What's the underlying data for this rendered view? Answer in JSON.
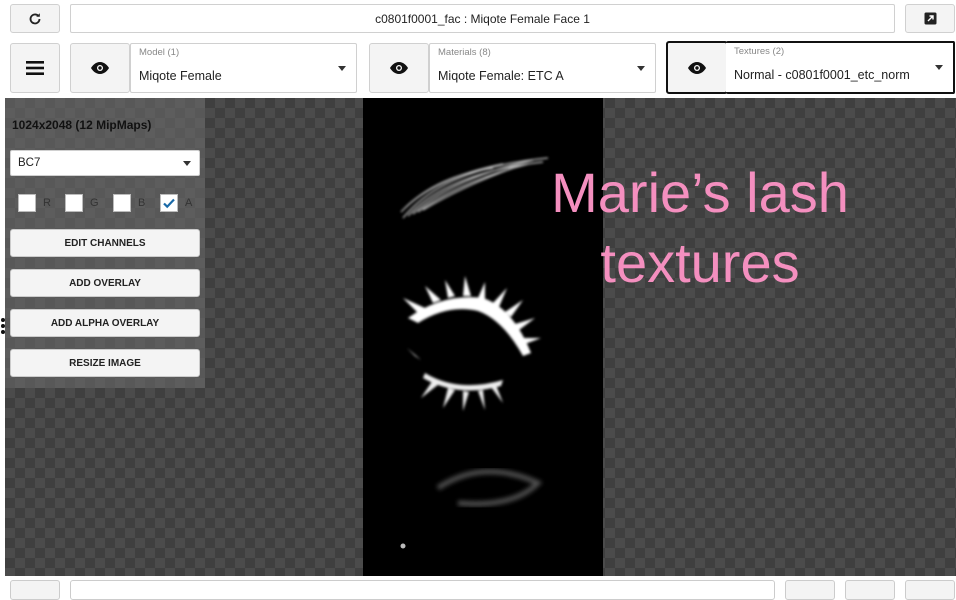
{
  "header": {
    "title": "c0801f0001_fac : Miqote Female Face 1",
    "refresh_icon": "refresh-icon",
    "popout_icon": "popout-icon"
  },
  "toolbar": {
    "menu_icon": "hamburger-icon",
    "model": {
      "label": "Model (1)",
      "value": "Miqote Female"
    },
    "materials": {
      "label": "Materials (8)",
      "value": "Miqote Female: ETC A"
    },
    "textures": {
      "label": "Textures (2)",
      "value": "Normal - c0801f0001_etc_norm"
    }
  },
  "panel": {
    "dimensions": "1024x2048 (12 MipMaps)",
    "format": "BC7",
    "channels": [
      {
        "label": "R",
        "checked": false
      },
      {
        "label": "G",
        "checked": false
      },
      {
        "label": "B",
        "checked": false
      },
      {
        "label": "A",
        "checked": true
      }
    ],
    "buttons": {
      "edit_channels": "EDIT CHANNELS",
      "add_overlay": "ADD OVERLAY",
      "add_alpha_overlay": "ADD ALPHA OVERLAY",
      "resize_image": "RESIZE IMAGE"
    }
  },
  "overlay": {
    "line1": "Marie’s lash",
    "line2": "textures"
  }
}
